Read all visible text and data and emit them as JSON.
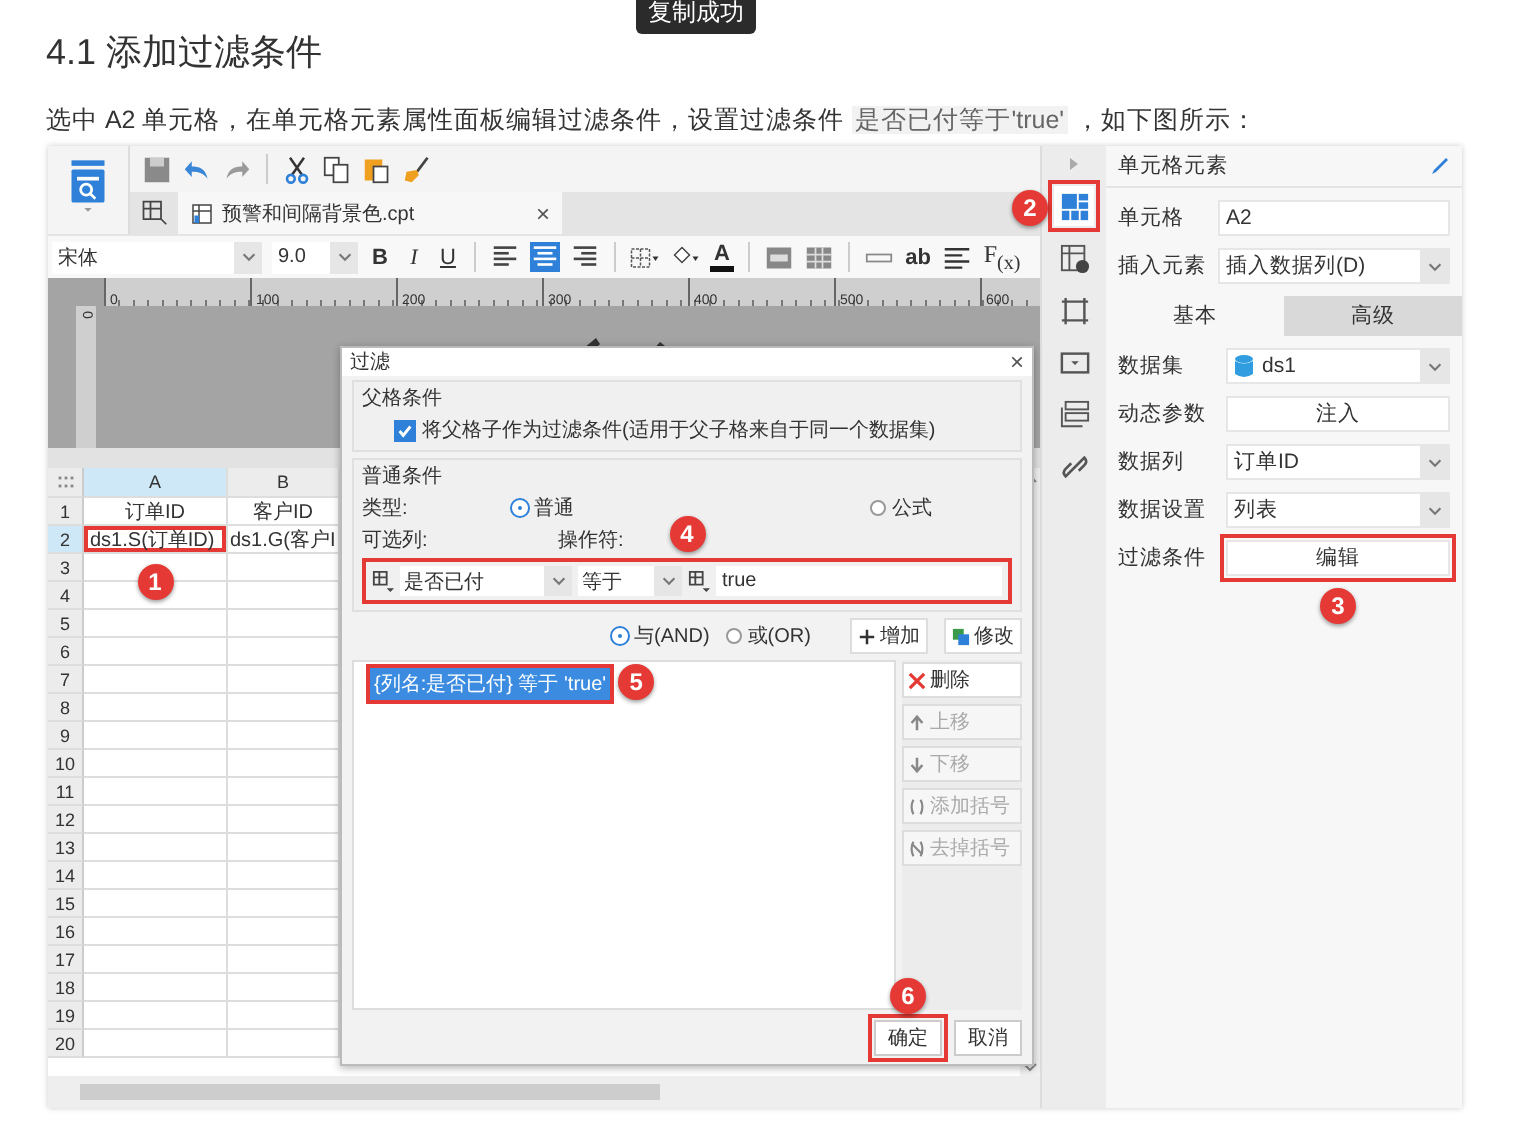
{
  "toast": "复制成功",
  "heading": "4.1 添加过滤条件",
  "intro": {
    "before": "选中 A2 单元格，在单元格元素属性面板编辑过滤条件，设置过滤条件 ",
    "code": "是否已付等于'true'",
    "after": " ，如下图所示："
  },
  "designer": {
    "tab": {
      "label": "预警和间隔背景色.cpt",
      "close": "×"
    },
    "font": {
      "family": "宋体",
      "size": "9.0"
    },
    "style_buttons": [
      "B",
      "I",
      "U"
    ],
    "align_buttons": [
      {
        "selected": false
      },
      {
        "selected": true
      },
      {
        "selected": false
      }
    ],
    "font_color_button": "A",
    "text_button": "ab",
    "formula_button": "F$_{(x)}$",
    "ruler_ticks": [
      "0",
      "100",
      "200",
      "300",
      "400",
      "500",
      "600"
    ],
    "vertical_ruler_tick": "0",
    "grid": {
      "columns": [
        {
          "label": "A",
          "selected": true
        },
        {
          "label": "B",
          "selected": false
        }
      ],
      "rows": [
        {
          "number": "1",
          "selected": false,
          "cells": [
            {
              "text": "订单ID"
            },
            {
              "text": "客户ID"
            }
          ]
        },
        {
          "number": "2",
          "selected": true,
          "cells": [
            {
              "text": "ds1.S(订单ID)",
              "callout": "1"
            },
            {
              "text": "ds1.G(客户I"
            }
          ]
        },
        {
          "number": "3",
          "selected": false,
          "cells": []
        },
        {
          "number": "4",
          "selected": false,
          "cells": []
        },
        {
          "number": "5",
          "selected": false,
          "cells": []
        },
        {
          "number": "6",
          "selected": false,
          "cells": []
        },
        {
          "number": "7",
          "selected": false,
          "cells": []
        },
        {
          "number": "8",
          "selected": false,
          "cells": []
        },
        {
          "number": "9",
          "selected": false,
          "cells": []
        },
        {
          "number": "10",
          "selected": false,
          "cells": []
        },
        {
          "number": "11",
          "selected": false,
          "cells": []
        },
        {
          "number": "12",
          "selected": false,
          "cells": []
        },
        {
          "number": "13",
          "selected": false,
          "cells": []
        },
        {
          "number": "14",
          "selected": false,
          "cells": []
        },
        {
          "number": "15",
          "selected": false,
          "cells": []
        },
        {
          "number": "16",
          "selected": false,
          "cells": []
        },
        {
          "number": "17",
          "selected": false,
          "cells": []
        },
        {
          "number": "18",
          "selected": false,
          "cells": []
        },
        {
          "number": "19",
          "selected": false,
          "cells": []
        },
        {
          "number": "20",
          "selected": false,
          "cells": []
        }
      ]
    }
  },
  "filter_dialog": {
    "title": "过滤",
    "close": "×",
    "parent_section": {
      "title": "父格条件",
      "label": "将父格子作为过滤条件(适用于父子格来自于同一个数据集)",
      "checked": true
    },
    "normal_section": {
      "title": "普通条件",
      "type_label": "类型:",
      "types": [
        {
          "label": "普通",
          "selected": true
        },
        {
          "label": "公式",
          "selected": false
        }
      ],
      "column_label": "可选列:",
      "operator_label": "操作符:"
    },
    "condition_editor": {
      "callout": "4",
      "column": "是否已付",
      "operator": "等于",
      "value": "true"
    },
    "logic": [
      {
        "label": "与(AND)",
        "selected": true
      },
      {
        "label": "或(OR)",
        "selected": false
      }
    ],
    "top_buttons": [
      {
        "label": "增加"
      },
      {
        "label": "修改"
      }
    ],
    "conditions": [
      {
        "text": "{列名:是否已付} 等于 'true'",
        "selected": true,
        "callout": "5"
      }
    ],
    "side_buttons": [
      {
        "label": "删除",
        "disabled": false
      },
      {
        "label": "上移",
        "disabled": true
      },
      {
        "label": "下移",
        "disabled": true
      },
      {
        "label": "添加括号",
        "disabled": true
      },
      {
        "label": "去掉括号",
        "disabled": true
      }
    ],
    "footer_buttons": [
      {
        "label": "确定",
        "callout": "6"
      },
      {
        "label": "取消"
      }
    ]
  },
  "side_tabs": [
    {
      "selected": true,
      "callout": "2"
    },
    {
      "selected": false
    },
    {
      "selected": false
    },
    {
      "selected": false
    },
    {
      "selected": false
    },
    {
      "selected": false
    }
  ],
  "properties": {
    "title": "单元格元素",
    "fields": [
      {
        "kind": "text",
        "label": "单元格",
        "value": "A2"
      },
      {
        "kind": "select",
        "label": "插入元素",
        "value": "插入数据列(D)"
      }
    ],
    "tabs": [
      {
        "label": "基本",
        "selected": true
      },
      {
        "label": "高级",
        "selected": false
      }
    ],
    "rows": [
      {
        "kind": "dataset",
        "label": "数据集",
        "value": "ds1"
      },
      {
        "kind": "button",
        "label": "动态参数",
        "value": "注入"
      },
      {
        "kind": "select",
        "label": "数据列",
        "value": "订单ID"
      },
      {
        "kind": "select",
        "label": "数据设置",
        "value": "列表"
      },
      {
        "kind": "button",
        "label": "过滤条件",
        "value": "编辑",
        "callout": "3"
      }
    ]
  }
}
